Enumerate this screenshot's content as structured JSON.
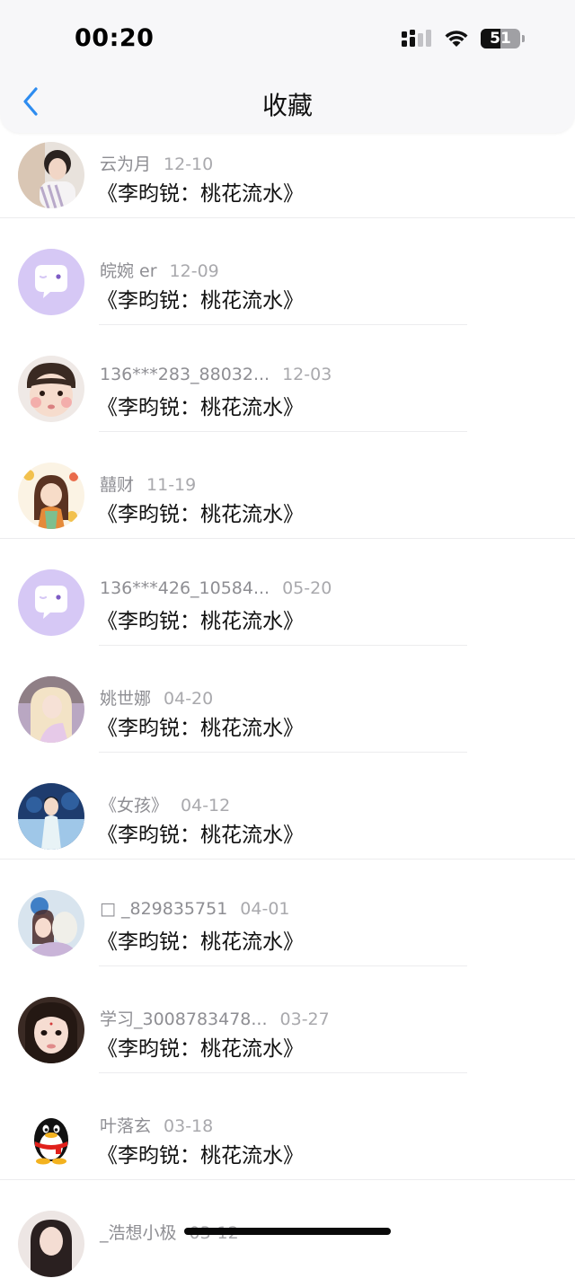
{
  "status_bar": {
    "time": "00:20",
    "battery": "51",
    "battery_level": 0.51
  },
  "nav": {
    "title": "收藏"
  },
  "items": [
    {
      "user": "云为月",
      "date": "12-10",
      "title": "《李昀锐：桃花流水》",
      "avatar_icon": "photo-avatar"
    },
    {
      "user": "皖婉 er",
      "date": "12-09",
      "title": "《李昀锐：桃花流水》",
      "avatar_icon": "chat-bubble-avatar"
    },
    {
      "user": "136***283_88032...",
      "date": "12-03",
      "title": "《李昀锐：桃花流水》",
      "avatar_icon": "photo-avatar"
    },
    {
      "user": "囍财",
      "date": "11-19",
      "title": "《李昀锐：桃花流水》",
      "avatar_icon": "illustration-avatar"
    },
    {
      "user": "136***426_10584...",
      "date": "05-20",
      "title": "《李昀锐：桃花流水》",
      "avatar_icon": "chat-bubble-avatar"
    },
    {
      "user": "姚世娜",
      "date": "04-20",
      "title": "《李昀锐：桃花流水》",
      "avatar_icon": "photo-avatar"
    },
    {
      "user": "《女孩》",
      "date": "04-12",
      "title": "《李昀锐：桃花流水》",
      "avatar_icon": "photo-avatar"
    },
    {
      "user": "□ _829835751",
      "date": "04-01",
      "title": "《李昀锐：桃花流水》",
      "avatar_icon": "photo-avatar"
    },
    {
      "user": "学习_3008783478...",
      "date": "03-27",
      "title": "《李昀锐：桃花流水》",
      "avatar_icon": "photo-avatar"
    },
    {
      "user": "叶落玄",
      "date": "03-18",
      "title": "《李昀锐：桃花流水》",
      "avatar_icon": "qq-penguin-avatar"
    },
    {
      "user": "_浩想小极",
      "date": "03-12",
      "title": "",
      "avatar_icon": "photo-avatar"
    }
  ],
  "colors": {
    "accent": "#2d8cf0",
    "chat_avatar_bg": "#d6c8f5",
    "header_bg": "#f7f7f9",
    "separator": "#ececee"
  }
}
